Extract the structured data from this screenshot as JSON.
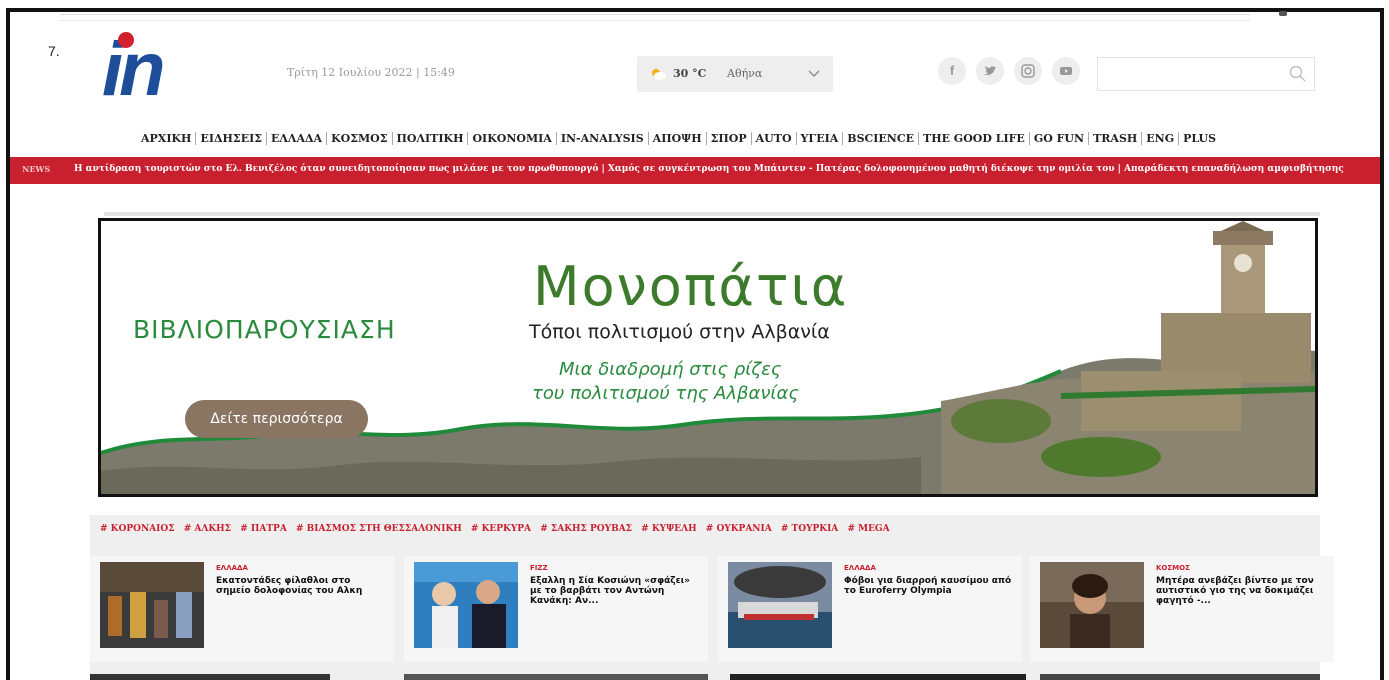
{
  "item_number": "7.",
  "logo": {
    "text": "in"
  },
  "header": {
    "date": "Τρίτη 12 Ιουλίου 2022 | 15:49",
    "weather": {
      "temp": "30 °C",
      "city": "Αθήνα"
    }
  },
  "social": [
    "f",
    "𝕪",
    "◎",
    "▶"
  ],
  "search": {
    "placeholder": ""
  },
  "nav": [
    "ΑΡΧΙΚΗ",
    "ΕΙΔΗΣΕΙΣ",
    "ΕΛΛΑΔΑ",
    "ΚΟΣΜΟΣ",
    "ΠΟΛΙΤΙΚΗ",
    "ΟΙΚΟΝΟΜΙΑ",
    "IN-ANALYSIS",
    "ΑΠΟΨΗ",
    "ΣΠΟΡ",
    "AUTO",
    "ΥΓΕΙΑ",
    "BSCIENCE",
    "THE GOOD LIFE",
    "GO FUN",
    "TRASH",
    "ENG",
    "PLUS"
  ],
  "ticker": {
    "label": "NEWS",
    "text": "Η αντίδραση τουριστών στο Ελ. Βενιζέλος όταν συνειδητοποίησαν πως μιλάνε με τον πρωθυπουργό   |   Χαμός σε συγκέντρωση του Μπάιντεν - Πατέρας δολοφονημένου μαθητή διέκοψε την ομιλία του   |   Απαράδεκτη επαναδήλωση αμφισβήτησης"
  },
  "banner": {
    "left_title": "ΒΙΒΛΙΟΠΑΡΟΥΣΙΑΣΗ",
    "title": "Μονοπάτια",
    "subtitle": "Τόποι πολιτισμού στην Αλβανία",
    "line1": "Μια διαδρομή στις ρίζες",
    "line2": "του πολιτισμού της Αλβανίας",
    "button": "Δείτε περισσότερα"
  },
  "tags": [
    "# ΚΟΡΟΝΑΙΟΣ",
    "# ΑΛΚΗΣ",
    "# ΠΑΤΡΑ",
    "# ΒΙΑΣΜΟΣ ΣΤΗ ΘΕΣΣΑΛΟΝΙΚΗ",
    "# ΚΕΡΚΥΡΑ",
    "# ΣΑΚΗΣ ΡΟΥΒΑΣ",
    "# ΚΥΨΕΛΗ",
    "# ΟΥΚΡΑΝΙΑ",
    "# ΤΟΥΡΚΙΑ",
    "# MEGA"
  ],
  "cards": [
    {
      "category": "ΕΛΛΑΔΑ",
      "title": "Εκατοντάδες φίλαθλοι στο σημείο δολοφονίας του Αλκη"
    },
    {
      "category": "FIZZ",
      "title": "Εξαλλη η Σία Κοσιώνη «σφάζει» με το βαρβάτι τον Αντώνη Κανάκη: Αν..."
    },
    {
      "category": "ΕΛΛΑΔΑ",
      "title": "Φόβοι για διαρροή καυσίμου από το Euroferry Olympia"
    },
    {
      "category": "ΚΟΣΜΟΣ",
      "title": "Μητέρα ανεβάζει βίντεο με τον αυτιστικό γιο της να δοκιμάζει φαγητό -..."
    }
  ],
  "colors": {
    "brand_red": "#c8202e",
    "logo_blue": "#1e4e9a",
    "banner_green": "#2a8a3e"
  }
}
